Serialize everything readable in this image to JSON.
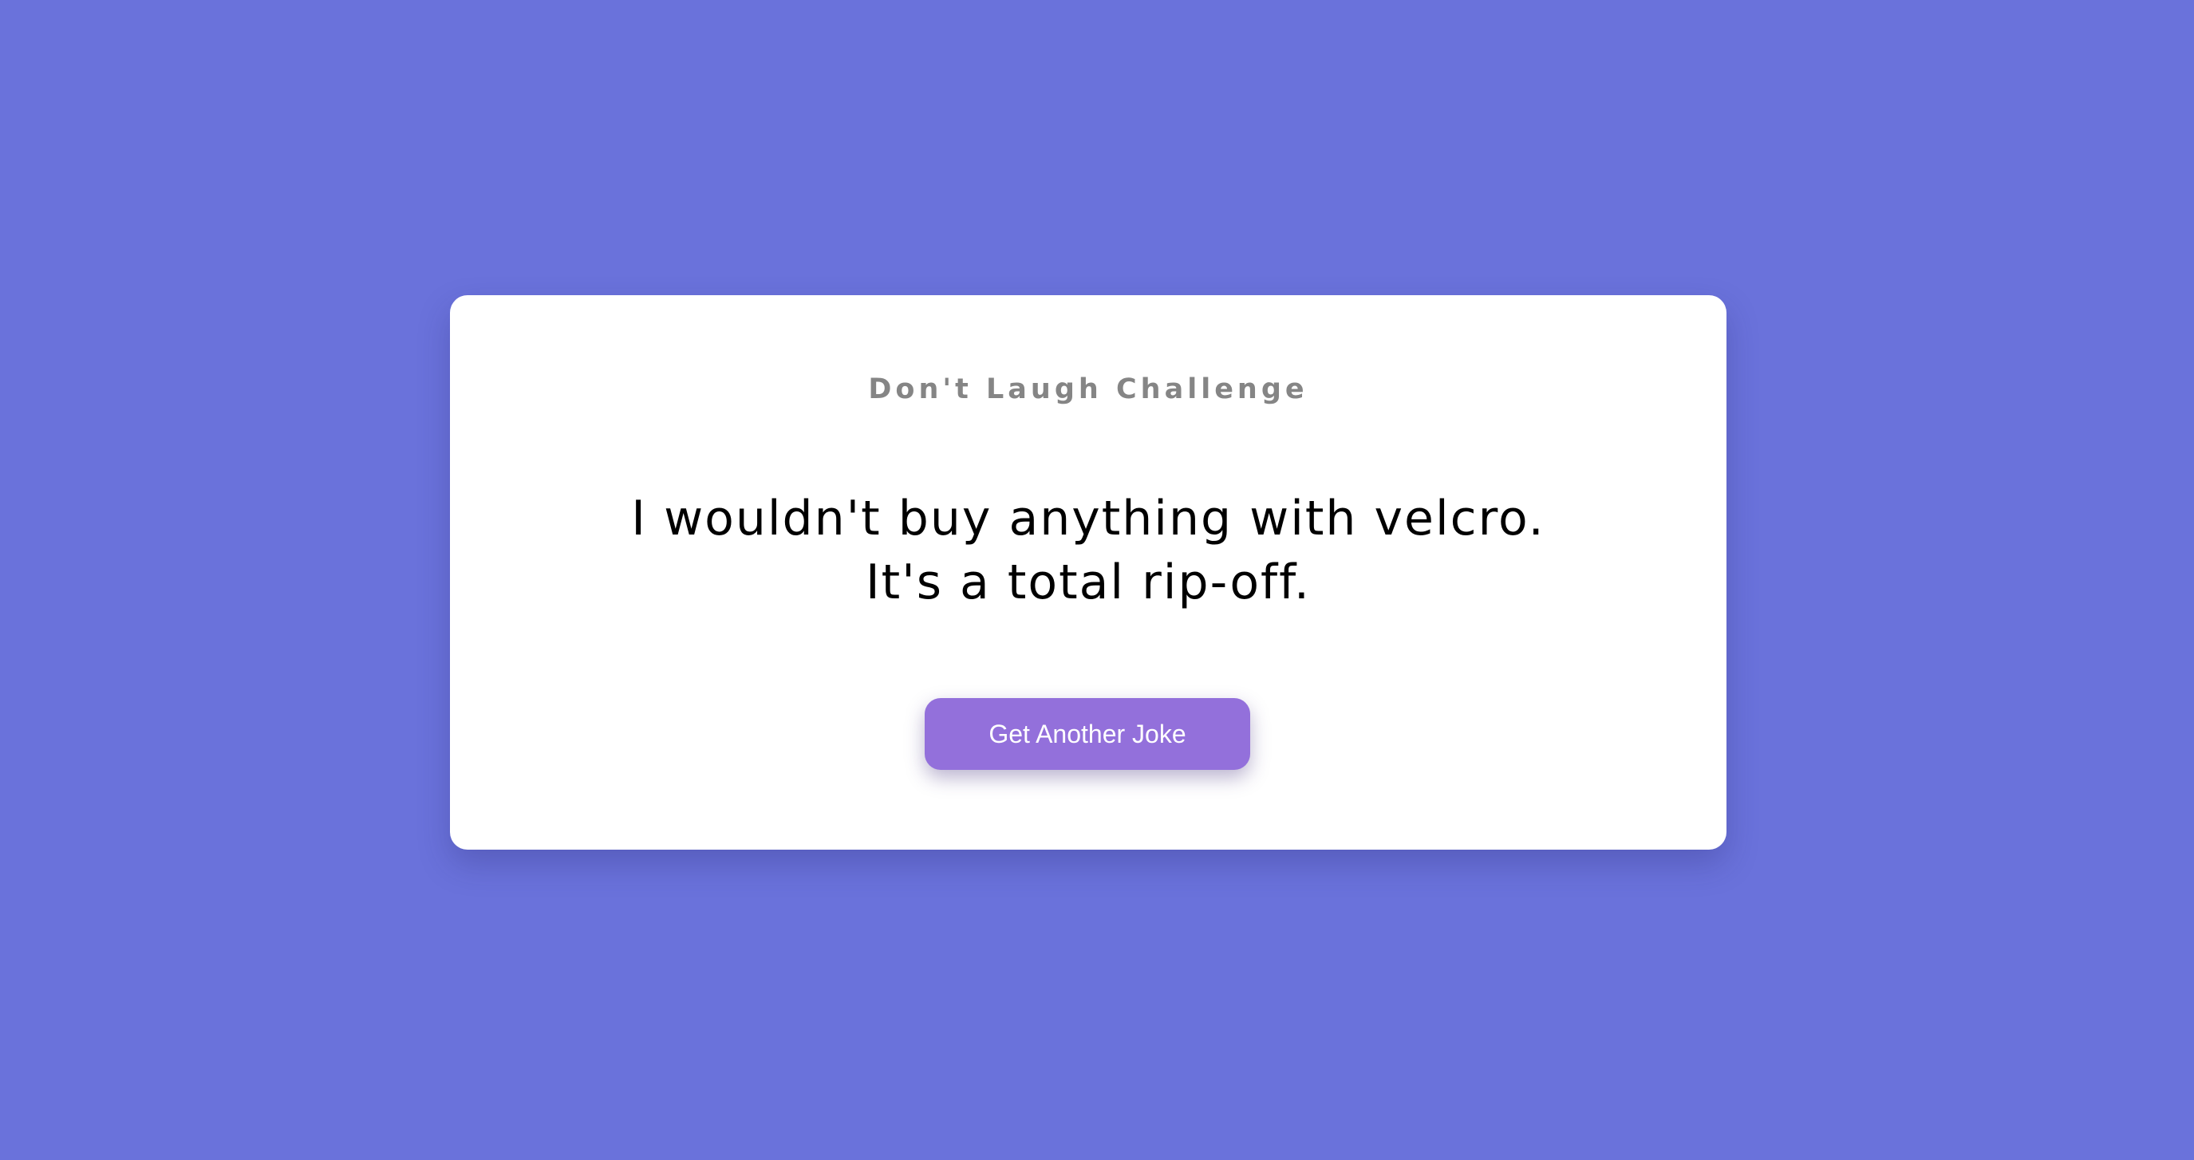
{
  "colors": {
    "background": "#6a72db",
    "card": "#ffffff",
    "title": "#858585",
    "joke": "#000000",
    "button": "#9370db",
    "button_text": "#ffffff"
  },
  "card": {
    "title": "Don't Laugh Challenge",
    "joke": "I wouldn't buy anything with velcro. It's a total rip-off.",
    "button_label": "Get Another Joke"
  }
}
